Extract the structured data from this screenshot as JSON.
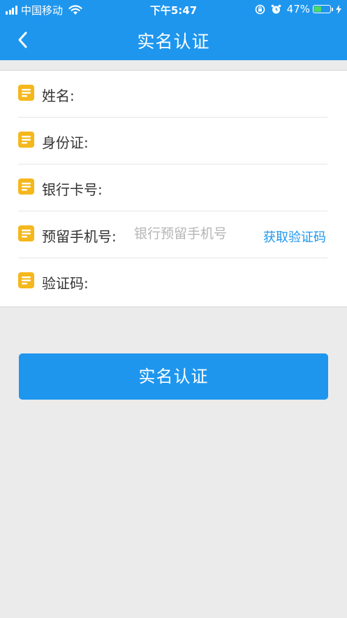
{
  "status_bar": {
    "carrier": "中国移动",
    "time": "下午5:47",
    "battery_percent": "47%",
    "battery_level": 0.47,
    "icons": [
      "signal-icon",
      "wifi-icon",
      "rotation-lock-icon",
      "alarm-icon",
      "battery-icon",
      "charging-bolt-icon"
    ]
  },
  "nav": {
    "title": "实名认证",
    "back_icon": "chevron-left-icon"
  },
  "form": {
    "rows": [
      {
        "label": "姓名:",
        "value": "",
        "placeholder": ""
      },
      {
        "label": "身份证:",
        "value": "",
        "placeholder": ""
      },
      {
        "label": "银行卡号:",
        "value": "",
        "placeholder": ""
      },
      {
        "label": "预留手机号:",
        "value": "",
        "placeholder": "银行预留手机号"
      },
      {
        "label": "验证码:",
        "value": "",
        "placeholder": ""
      }
    ],
    "get_code_label": "获取验证码",
    "row_icon": "note-icon"
  },
  "submit_label": "实名认证",
  "colors": {
    "primary": "#1e96ee",
    "background": "#ebebeb",
    "row_icon": "#f5b81c",
    "battery_fill": "#4cd964"
  }
}
